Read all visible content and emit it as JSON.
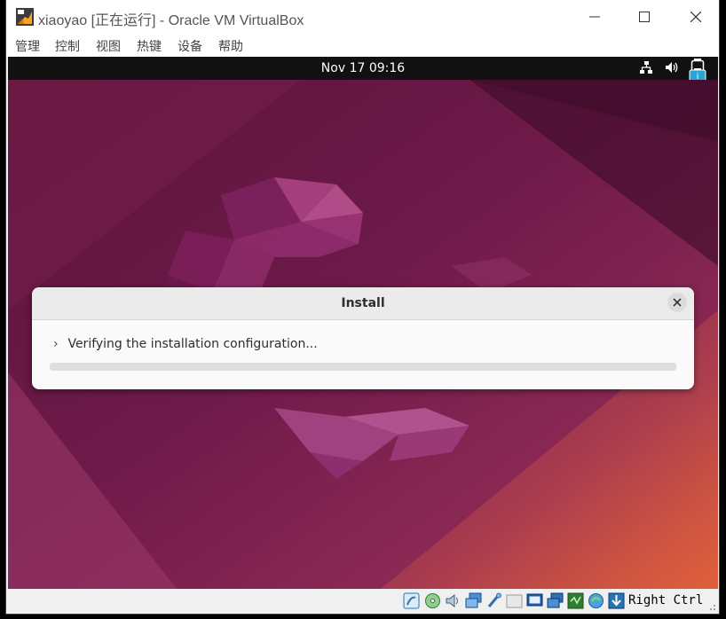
{
  "window": {
    "title": "xiaoyao [正在运行] - Oracle VM VirtualBox",
    "menu": [
      "管理",
      "控制",
      "视图",
      "热键",
      "设备",
      "帮助"
    ]
  },
  "guest": {
    "topbar": {
      "clock": "Nov 17  09:16"
    },
    "install_dialog": {
      "title": "Install",
      "status": "Verifying the installation configuration...",
      "progress": 0
    }
  },
  "statusbar": {
    "host_key": "Right Ctrl",
    "icons": [
      "hard-disk-icon",
      "optical-drive-icon",
      "audio-icon",
      "network-icon",
      "usb-icon",
      "shared-folders-icon",
      "display-icon",
      "video-capture-icon",
      "cpu-activity-icon",
      "mouse-integration-icon",
      "host-key-arrow-icon"
    ]
  },
  "colors": {
    "progress_fill": "#e95420",
    "wallpaper_dark": "#3e1029",
    "wallpaper_mid": "#7b1f52",
    "wallpaper_warm": "#d2553a"
  }
}
